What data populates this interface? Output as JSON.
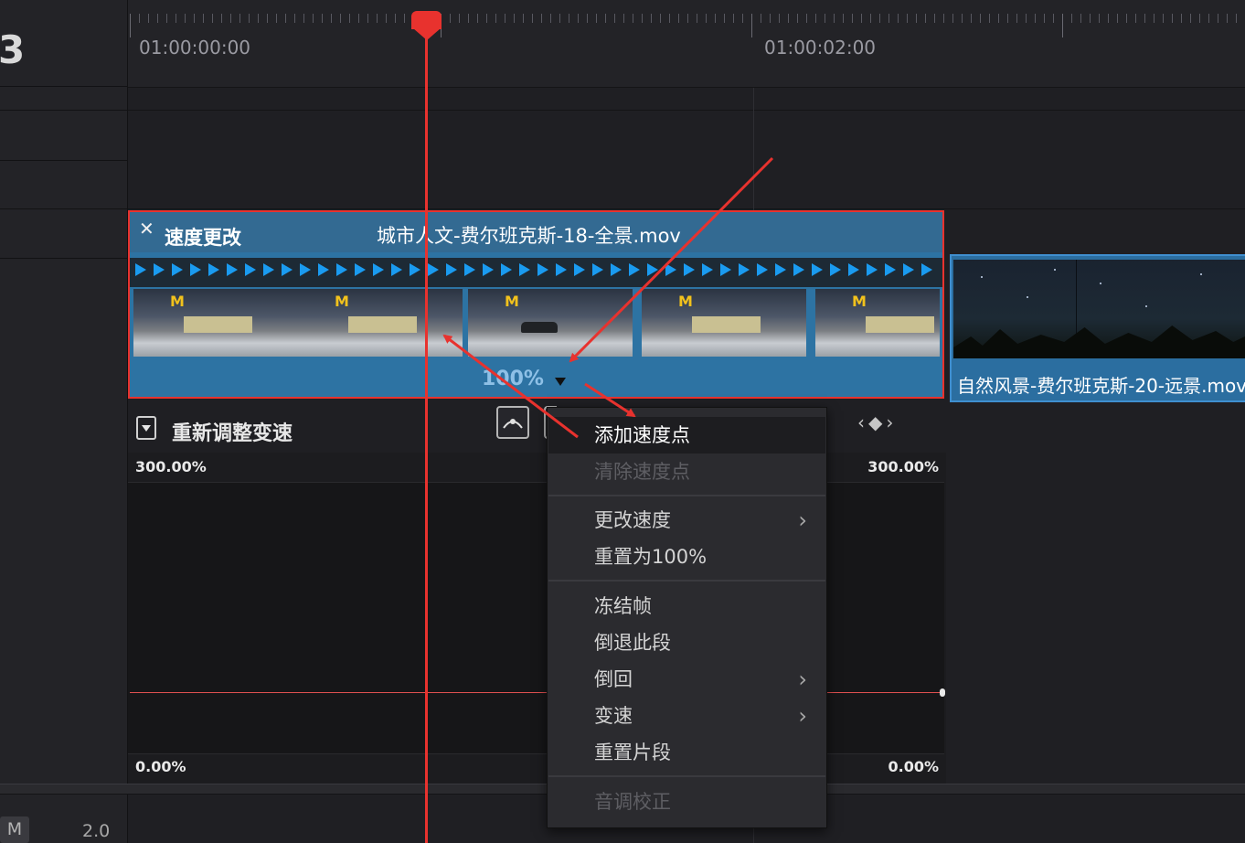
{
  "track": {
    "number": "3",
    "mute_label": "M",
    "value": "2.0"
  },
  "ruler": {
    "timecodes": [
      "01:00:00:00",
      "01:00:02:00"
    ]
  },
  "clip": {
    "close_glyph": "✕",
    "effect_label": "速度更改",
    "name": "城市人文-费尔班克斯-18-全景.mov",
    "thumbnail_logo": "M",
    "speed": "100%"
  },
  "next_clip": {
    "name": "自然风景-费尔班克斯-20-远景.mov"
  },
  "retime": {
    "title": "重新调整变速",
    "keyframe_nav": "‹◆›",
    "top_left": "300.00%",
    "top_right": "300.00%",
    "bottom_left": "0.00%",
    "bottom_right": "0.00%"
  },
  "context_menu": {
    "items": [
      {
        "label": "添加速度点",
        "state": "active"
      },
      {
        "label": "清除速度点",
        "state": "disabled"
      },
      {
        "label": "更改速度",
        "state": "normal",
        "submenu": true
      },
      {
        "label": "重置为100%",
        "state": "normal"
      },
      {
        "label": "冻结帧",
        "state": "normal"
      },
      {
        "label": "倒退此段",
        "state": "normal"
      },
      {
        "label": "倒回",
        "state": "normal",
        "submenu": true
      },
      {
        "label": "变速",
        "state": "normal",
        "submenu": true
      },
      {
        "label": "重置片段",
        "state": "normal"
      },
      {
        "label": "音调校正",
        "state": "disabled"
      }
    ],
    "submenu_glyph": "›"
  },
  "colors": {
    "playhead": "#e8322e",
    "clip": "#2d73a3",
    "speed_arrows": "#1a9bf0"
  }
}
